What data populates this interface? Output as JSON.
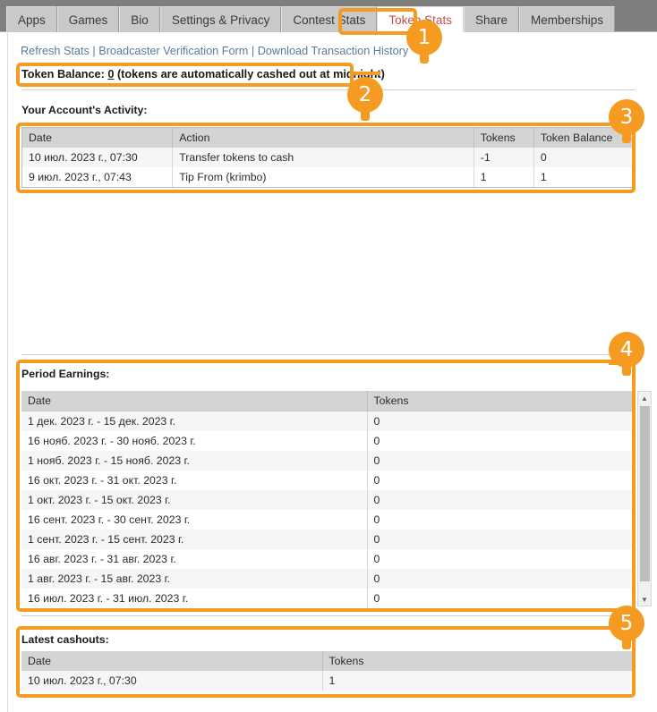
{
  "tabs": [
    {
      "label": "Apps",
      "active": false
    },
    {
      "label": "Games",
      "active": false
    },
    {
      "label": "Bio",
      "active": false
    },
    {
      "label": "Settings & Privacy",
      "active": false
    },
    {
      "label": "Contest Stats",
      "active": false
    },
    {
      "label": "Token Stats",
      "active": true
    },
    {
      "label": "Share",
      "active": false
    },
    {
      "label": "Memberships",
      "active": false
    }
  ],
  "links": {
    "refresh": "Refresh Stats",
    "verification": "Broadcaster Verification Form",
    "download": "Download Transaction History",
    "separator": " | "
  },
  "balance": {
    "prefix": "Token Balance: ",
    "value": "0",
    "suffix": " (tokens are automatically cashed out at midnight)"
  },
  "activity": {
    "title": "Your Account's Activity:",
    "columns": [
      "Date",
      "Action",
      "Tokens",
      "Token Balance"
    ],
    "rows": [
      [
        "10 июл. 2023 г., 07:30",
        "Transfer tokens to cash",
        "-1",
        "0"
      ],
      [
        "9 июл. 2023 г., 07:43",
        "Tip From (krimbo)",
        "1",
        "1"
      ]
    ]
  },
  "period_earnings": {
    "title": "Period Earnings:",
    "columns": [
      "Date",
      "Tokens"
    ],
    "rows": [
      [
        "1 дек. 2023 г. - 15 дек. 2023 г.",
        "0"
      ],
      [
        "16 нояб. 2023 г. - 30 нояб. 2023 г.",
        "0"
      ],
      [
        "1 нояб. 2023 г. - 15 нояб. 2023 г.",
        "0"
      ],
      [
        "16 окт. 2023 г. - 31 окт. 2023 г.",
        "0"
      ],
      [
        "1 окт. 2023 г. - 15 окт. 2023 г.",
        "0"
      ],
      [
        "16 сент. 2023 г. - 30 сент. 2023 г.",
        "0"
      ],
      [
        "1 сент. 2023 г. - 15 сент. 2023 г.",
        "0"
      ],
      [
        "16 авг. 2023 г. - 31 авг. 2023 г.",
        "0"
      ],
      [
        "1 авг. 2023 г. - 15 авг. 2023 г.",
        "0"
      ],
      [
        "16 июл. 2023 г. - 31 июл. 2023 г.",
        "0"
      ]
    ],
    "scrollbar": {
      "up_arrow": "▲",
      "down_arrow": "▼"
    }
  },
  "cashouts": {
    "title": "Latest cashouts:",
    "columns": [
      "Date",
      "Tokens"
    ],
    "rows": [
      [
        "10 июл. 2023 г., 07:30",
        "1"
      ]
    ]
  },
  "annotations": {
    "accent_color": "#f59b21",
    "badges": [
      "1",
      "2",
      "3",
      "4",
      "5"
    ]
  }
}
